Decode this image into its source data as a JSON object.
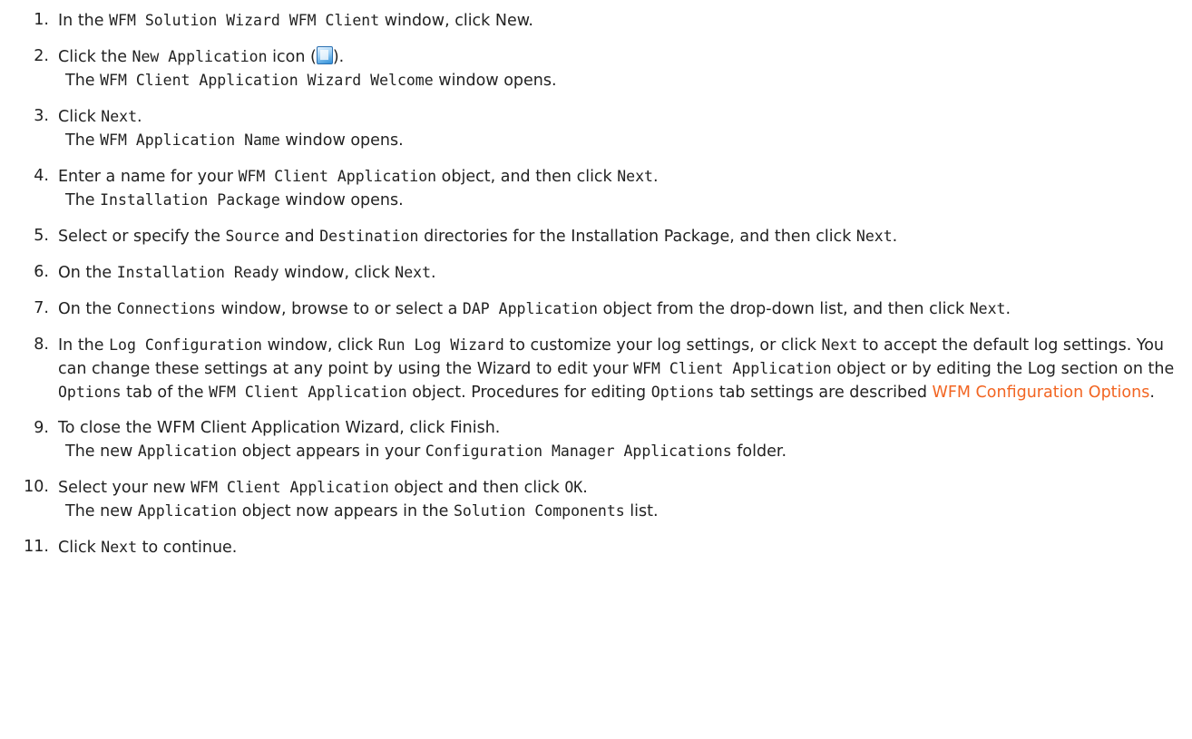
{
  "steps": [
    {
      "num": "1.",
      "parts": [
        {
          "t": "In the "
        },
        {
          "t": "WFM Solution Wizard WFM Client",
          "c": 1
        },
        {
          "t": " window, click New."
        }
      ]
    },
    {
      "num": "2.",
      "parts": [
        {
          "t": "Click the "
        },
        {
          "t": "New Application",
          "c": 1
        },
        {
          "t": " icon ("
        },
        {
          "icon": "new-application-icon"
        },
        {
          "t": ")."
        }
      ],
      "result": [
        {
          "t": "The "
        },
        {
          "t": "WFM Client Application Wizard Welcome",
          "c": 1
        },
        {
          "t": " window opens."
        }
      ]
    },
    {
      "num": "3.",
      "parts": [
        {
          "t": "Click "
        },
        {
          "t": "Next",
          "c": 1
        },
        {
          "t": "."
        }
      ],
      "result": [
        {
          "t": "The "
        },
        {
          "t": "WFM Application Name",
          "c": 1
        },
        {
          "t": " window opens."
        }
      ]
    },
    {
      "num": "4.",
      "parts": [
        {
          "t": "Enter a name for your "
        },
        {
          "t": "WFM Client Application",
          "c": 1
        },
        {
          "t": " object, and then click "
        },
        {
          "t": "Next",
          "c": 1
        },
        {
          "t": "."
        }
      ],
      "result": [
        {
          "t": "The "
        },
        {
          "t": "Installation Package",
          "c": 1
        },
        {
          "t": " window opens."
        }
      ]
    },
    {
      "num": "5.",
      "parts": [
        {
          "t": "Select or specify the "
        },
        {
          "t": "Source",
          "c": 1
        },
        {
          "t": " and "
        },
        {
          "t": "Destination",
          "c": 1
        },
        {
          "t": " directories for the Installation Package, and then click "
        },
        {
          "t": "Next",
          "c": 1
        },
        {
          "t": "."
        }
      ]
    },
    {
      "num": "6.",
      "parts": [
        {
          "t": "On the "
        },
        {
          "t": "Installation Ready",
          "c": 1
        },
        {
          "t": " window, click "
        },
        {
          "t": "Next",
          "c": 1
        },
        {
          "t": "."
        }
      ]
    },
    {
      "num": "7.",
      "parts": [
        {
          "t": "On the "
        },
        {
          "t": "Connections",
          "c": 1
        },
        {
          "t": " window, browse to or select a "
        },
        {
          "t": "DAP Application",
          "c": 1
        },
        {
          "t": " object from the drop-down list, and then click "
        },
        {
          "t": "Next",
          "c": 1
        },
        {
          "t": "."
        }
      ]
    },
    {
      "num": "8.",
      "parts": [
        {
          "t": "In the "
        },
        {
          "t": "Log Configuration",
          "c": 1
        },
        {
          "t": " window, click "
        },
        {
          "t": "Run Log Wizard",
          "c": 1
        },
        {
          "t": " to customize your log settings, or click "
        },
        {
          "t": "Next",
          "c": 1
        },
        {
          "t": " to accept the default log settings. You can change these settings at any point by using the Wizard to edit your "
        },
        {
          "t": "WFM Client Application",
          "c": 1
        },
        {
          "t": " object or by editing the Log section on the "
        },
        {
          "t": "Options",
          "c": 1
        },
        {
          "t": " tab of the "
        },
        {
          "t": "WFM Client Application",
          "c": 1
        },
        {
          "t": " object. Procedures for editing "
        },
        {
          "t": "Options",
          "c": 1
        },
        {
          "t": " tab settings are described "
        },
        {
          "t": "WFM Configuration Options",
          "link": 1
        },
        {
          "t": "."
        }
      ]
    },
    {
      "num": "9.",
      "parts": [
        {
          "t": "To close the WFM Client Application Wizard, click Finish."
        }
      ],
      "result": [
        {
          "t": "The new "
        },
        {
          "t": "Application",
          "c": 1
        },
        {
          "t": " object appears in your "
        },
        {
          "t": "Configuration Manager Applications",
          "c": 1
        },
        {
          "t": " folder."
        }
      ]
    },
    {
      "num": "10.",
      "parts": [
        {
          "t": "Select your new "
        },
        {
          "t": "WFM Client Application",
          "c": 1
        },
        {
          "t": " object and then click "
        },
        {
          "t": "OK",
          "c": 1
        },
        {
          "t": "."
        }
      ],
      "result": [
        {
          "t": "The new "
        },
        {
          "t": "Application",
          "c": 1
        },
        {
          "t": " object now appears in the "
        },
        {
          "t": "Solution Components",
          "c": 1
        },
        {
          "t": " list."
        }
      ]
    },
    {
      "num": "11.",
      "parts": [
        {
          "t": "Click "
        },
        {
          "t": "Next",
          "c": 1
        },
        {
          "t": " to continue."
        }
      ]
    }
  ]
}
